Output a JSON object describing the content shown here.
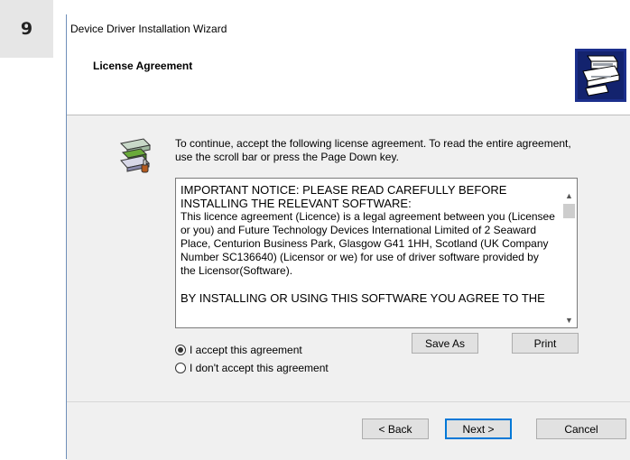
{
  "step_number": "9",
  "window": {
    "title": "Device Driver Installation Wizard"
  },
  "header": {
    "title": "License Agreement",
    "icon": "device-installer-icon"
  },
  "intro": "To continue, accept the following license agreement. To read the entire agreement, use the scroll bar or press the Page Down key.",
  "license": {
    "paragraphs": [
      "IMPORTANT NOTICE: PLEASE READ CAREFULLY BEFORE INSTALLING THE RELEVANT SOFTWARE:",
      "This licence agreement (Licence) is a legal agreement between you (Licensee or you) and Future Technology Devices International Limited of 2 Seaward Place, Centurion Business Park, Glasgow G41 1HH, Scotland (UK Company Number SC136640) (Licensor or we) for use of driver software provided by the Licensor(Software).",
      "BY INSTALLING OR USING THIS SOFTWARE YOU AGREE TO THE"
    ]
  },
  "options": {
    "accept": "I accept this agreement",
    "decline": "I don't accept this agreement",
    "selected": "accept"
  },
  "buttons": {
    "save_as": "Save As",
    "print": "Print",
    "back": "< Back",
    "next": "Next >",
    "cancel": "Cancel"
  },
  "colors": {
    "accent": "#0078d7",
    "panel": "#f0f0f0",
    "badge": "#e6e6e6"
  }
}
